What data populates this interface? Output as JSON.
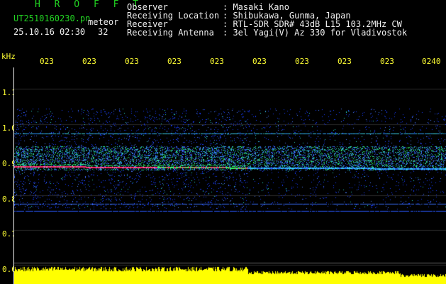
{
  "header": {
    "brand": "HROFFT",
    "file_name": "UT2510160230.pn",
    "mode": "meteor",
    "datetime": "25.10.16 02:30",
    "count": "32",
    "observer_label": "Observer",
    "observer_value": ": Masaki Kano",
    "location_label": "Receiving Location",
    "location_value": ": Shibukawa, Gunma, Japan",
    "receiver_label": "Receiver",
    "receiver_value": ": RTL-SDR SDR# 43dB L15 103.2MHz CW",
    "antenna_label": "Receiving Antenna",
    "antenna_value": ": 3el Yagi(V) Az 330 for Vladivostok"
  },
  "axis": {
    "unit": "kHz",
    "y_ticks": [
      "1.1",
      "1.0",
      "0.9",
      "0.8",
      "0.7",
      "0.6"
    ],
    "x_ticks": [
      "023",
      "023",
      "023",
      "023",
      "023",
      "023",
      "023",
      "023",
      "023",
      "0240"
    ]
  },
  "colors": {
    "header_green": "#22d422",
    "header_white": "#f0f0f0",
    "time_labels": "#ffff33",
    "background": "#000000",
    "signal_hot": "#ff2a6a",
    "signal_warm": "#33ff66",
    "noise_blue": "#1a3cff",
    "level_bar": "#ffff00"
  }
}
